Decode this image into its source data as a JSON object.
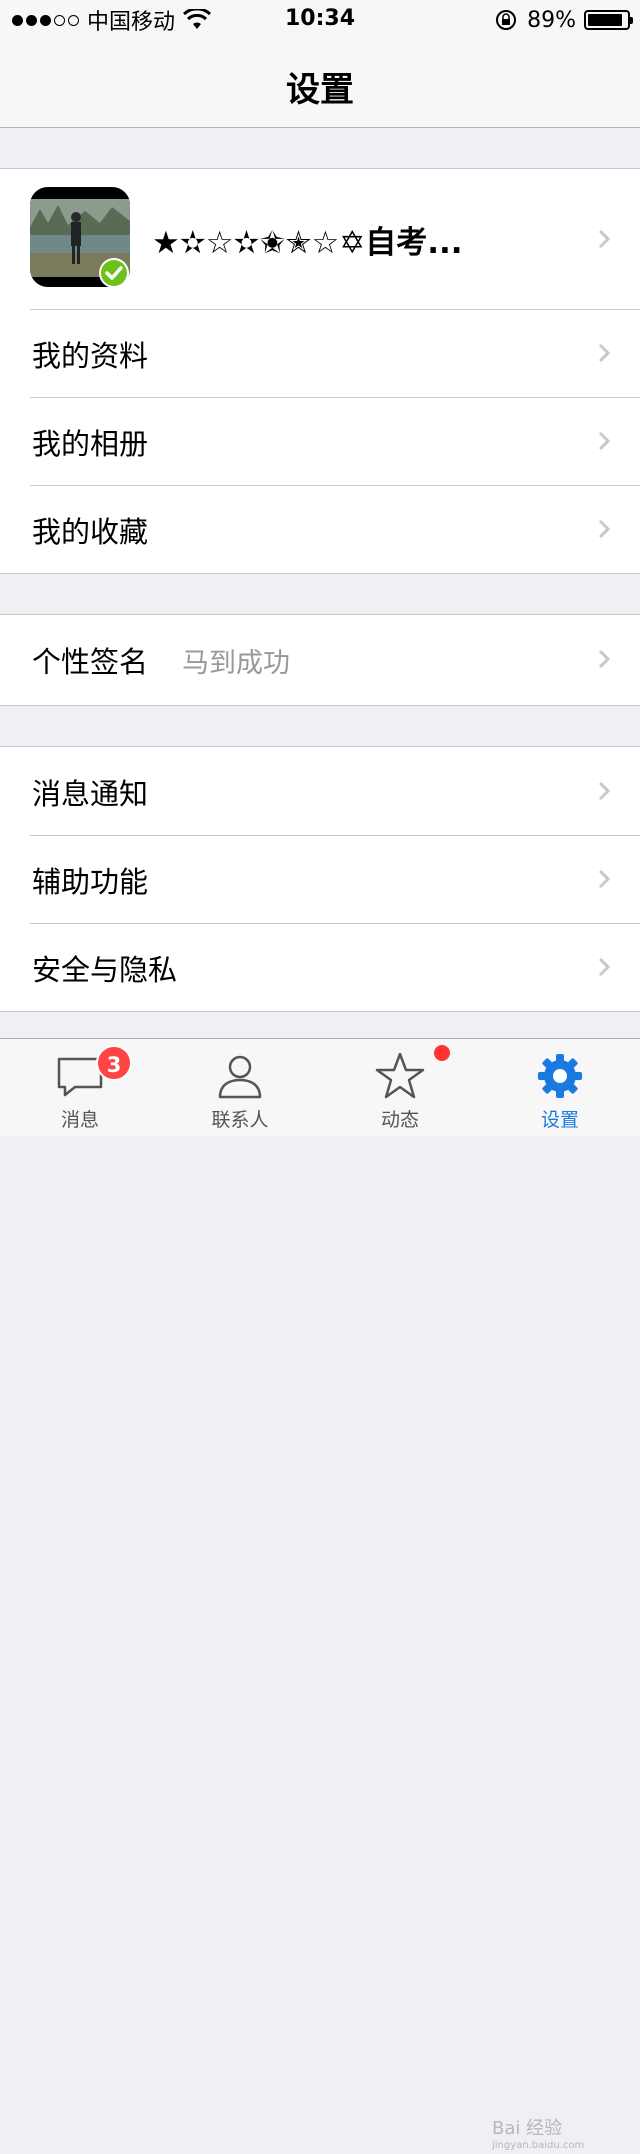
{
  "status_bar": {
    "carrier": "中国移动",
    "time": "10:34",
    "battery_text": "89%",
    "battery_level": 0.89
  },
  "nav": {
    "title": "设置"
  },
  "profile": {
    "name": "★✫☆✫✬✭☆✡自考...",
    "avatar_icon": "user-photo",
    "verified_icon": "check-circle-icon"
  },
  "groups": {
    "account": [
      "我的资料",
      "我的相册",
      "我的收藏"
    ],
    "signature": {
      "label": "个性签名",
      "value": "马到成功"
    },
    "settings": [
      "消息通知",
      "辅助功能",
      "安全与隐私"
    ]
  },
  "tabs": [
    {
      "label": "消息",
      "icon": "chat-bubble-icon",
      "badge": "3"
    },
    {
      "label": "联系人",
      "icon": "person-icon"
    },
    {
      "label": "动态",
      "icon": "star-icon",
      "dot": true
    },
    {
      "label": "设置",
      "icon": "gear-icon",
      "active": true
    }
  ],
  "watermark": {
    "text": "Bai 经验",
    "subtext": "jingyan.baidu.com"
  },
  "colors": {
    "accent": "#1a7ae0",
    "badge": "#ff4444",
    "background": "#efeff4",
    "secondary_text": "#999999"
  }
}
